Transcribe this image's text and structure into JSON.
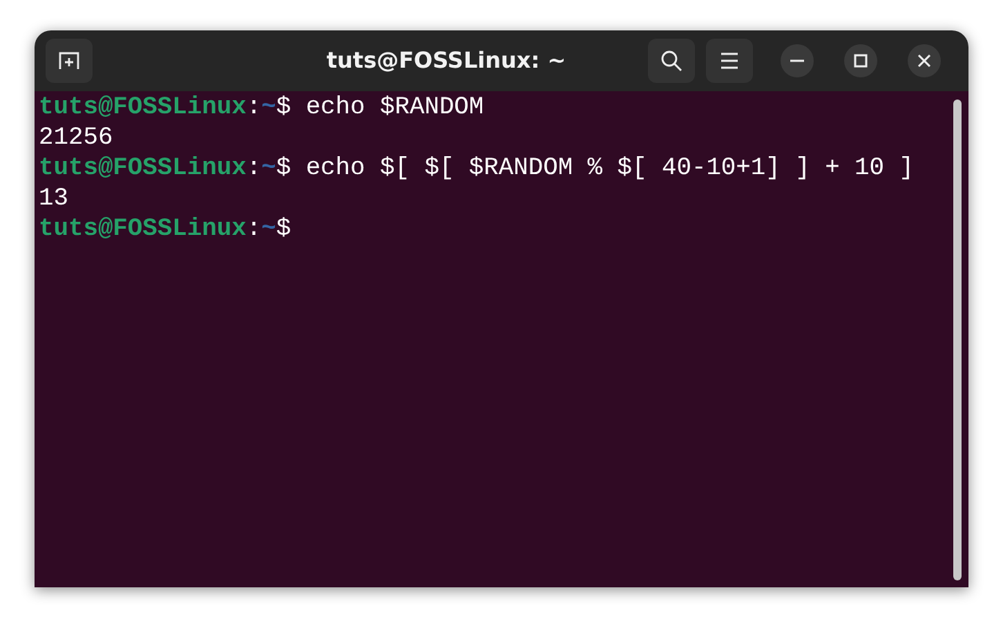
{
  "window": {
    "title": "tuts@FOSSLinux: ~"
  },
  "terminal": {
    "lines": [
      {
        "kind": "prompt",
        "user": "tuts@FOSSLinux",
        "separator": ":",
        "path": "~",
        "symbol": "$",
        "command": "echo $RANDOM"
      },
      {
        "kind": "output",
        "text": "21256"
      },
      {
        "kind": "prompt",
        "user": "tuts@FOSSLinux",
        "separator": ":",
        "path": "~",
        "symbol": "$",
        "command": "echo $[ $[ $RANDOM % $[ 40-10+1] ] + 10 ]"
      },
      {
        "kind": "output",
        "text": "13"
      },
      {
        "kind": "prompt",
        "user": "tuts@FOSSLinux",
        "separator": ":",
        "path": "~",
        "symbol": "$"
      }
    ]
  }
}
